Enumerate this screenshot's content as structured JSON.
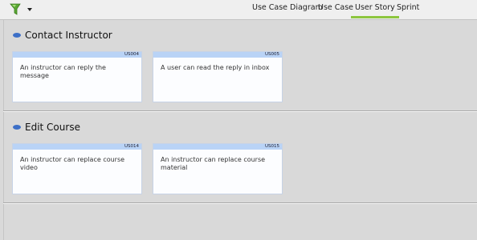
{
  "toolbar": {
    "filter_icon": "filter-funnel-icon",
    "dropdown_icon": "caret-down-icon",
    "tabs": [
      "Use Case Diagram",
      "Use Case",
      "User Story",
      "Sprint"
    ],
    "active_tab": "User Story",
    "accent_color": "#8dc63f"
  },
  "sections": [
    {
      "title": "Contact Instructor",
      "cards": [
        {
          "id": "US004",
          "text": "An instructor can reply the message"
        },
        {
          "id": "US005",
          "text": "A user can read the reply in inbox"
        }
      ]
    },
    {
      "title": "Edit Course",
      "cards": [
        {
          "id": "US014",
          "text": "An instructor can replace course video"
        },
        {
          "id": "US015",
          "text": "An instructor can replace course material"
        }
      ]
    }
  ],
  "colors": {
    "bullet": "#3d6fc7",
    "card_header": "#b9d3f6"
  }
}
